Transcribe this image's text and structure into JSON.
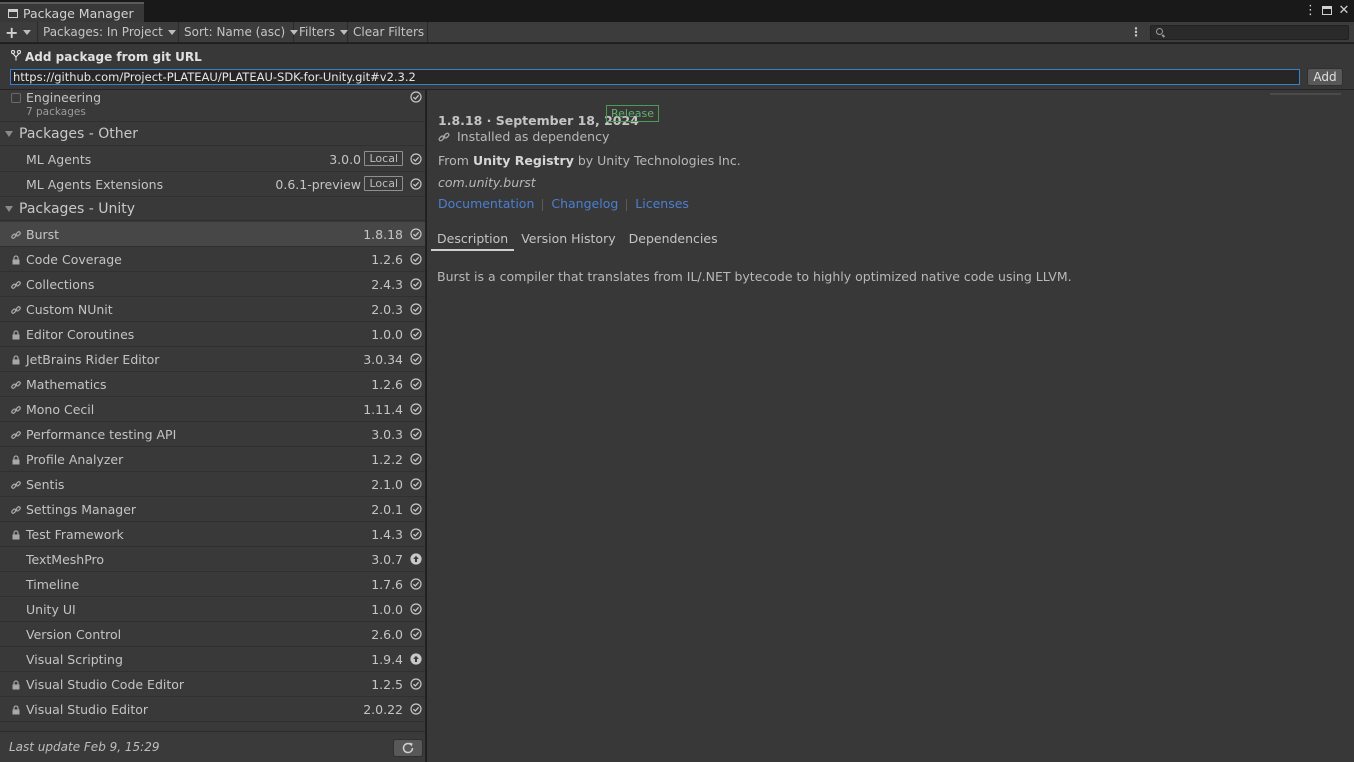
{
  "window": {
    "title": "Package Manager"
  },
  "toolbar": {
    "add_label": "+",
    "packages_filter": "Packages: In Project",
    "sort": "Sort: Name (asc)",
    "filters": "Filters",
    "clear_filters": "Clear Filters",
    "search_placeholder": ""
  },
  "git_panel": {
    "title": "Add package from git URL",
    "url": "https://github.com/Project-PLATEAU/PLATEAU-SDK-for-Unity.git#v2.3.2",
    "add_button": "Add"
  },
  "engineering": {
    "name": "Engineering",
    "count": "7 packages"
  },
  "groups": [
    {
      "name": "Packages - Other",
      "items": [
        {
          "name": "ML Agents",
          "version": "3.0.0",
          "badge": "Local",
          "icon": "none",
          "status": "check-icon"
        },
        {
          "name": "ML Agents Extensions",
          "version": "0.6.1-preview",
          "badge": "Local",
          "icon": "none",
          "status": "check-icon"
        }
      ]
    },
    {
      "name": "Packages - Unity",
      "items": [
        {
          "name": "Burst",
          "version": "1.8.18",
          "icon": "link-icon",
          "status": "check-icon",
          "selected": true
        },
        {
          "name": "Code Coverage",
          "version": "1.2.6",
          "icon": "lock-icon",
          "status": "check-icon"
        },
        {
          "name": "Collections",
          "version": "2.4.3",
          "icon": "link-icon",
          "status": "check-icon"
        },
        {
          "name": "Custom NUnit",
          "version": "2.0.3",
          "icon": "link-icon",
          "status": "check-icon"
        },
        {
          "name": "Editor Coroutines",
          "version": "1.0.0",
          "icon": "lock-icon",
          "status": "check-icon"
        },
        {
          "name": "JetBrains Rider Editor",
          "version": "3.0.34",
          "icon": "lock-icon",
          "status": "check-icon"
        },
        {
          "name": "Mathematics",
          "version": "1.2.6",
          "icon": "link-icon",
          "status": "check-icon"
        },
        {
          "name": "Mono Cecil",
          "version": "1.11.4",
          "icon": "link-icon",
          "status": "check-icon"
        },
        {
          "name": "Performance testing API",
          "version": "3.0.3",
          "icon": "link-icon",
          "status": "check-icon"
        },
        {
          "name": "Profile Analyzer",
          "version": "1.2.2",
          "icon": "lock-icon",
          "status": "check-icon"
        },
        {
          "name": "Sentis",
          "version": "2.1.0",
          "icon": "link-icon",
          "status": "check-icon"
        },
        {
          "name": "Settings Manager",
          "version": "2.0.1",
          "icon": "link-icon",
          "status": "check-icon"
        },
        {
          "name": "Test Framework",
          "version": "1.4.3",
          "icon": "lock-icon",
          "status": "check-icon"
        },
        {
          "name": "TextMeshPro",
          "version": "3.0.7",
          "icon": "none",
          "status": "update-icon"
        },
        {
          "name": "Timeline",
          "version": "1.7.6",
          "icon": "none",
          "status": "check-icon"
        },
        {
          "name": "Unity UI",
          "version": "1.0.0",
          "icon": "none",
          "status": "check-icon"
        },
        {
          "name": "Version Control",
          "version": "2.6.0",
          "icon": "none",
          "status": "check-icon"
        },
        {
          "name": "Visual Scripting",
          "version": "1.9.4",
          "icon": "none",
          "status": "update-icon"
        },
        {
          "name": "Visual Studio Code Editor",
          "version": "1.2.5",
          "icon": "lock-icon",
          "status": "check-icon"
        },
        {
          "name": "Visual Studio Editor",
          "version": "2.0.22",
          "icon": "lock-icon",
          "status": "check-icon"
        }
      ]
    }
  ],
  "footer": {
    "last_update": "Last update Feb 9, 15:29"
  },
  "details": {
    "version_line": "1.8.18 · September 18, 2024",
    "release_badge": "Release",
    "dependency": "Installed as dependency",
    "from_prefix": "From",
    "registry": "Unity Registry",
    "by": "by Unity Technologies Inc.",
    "package_id": "com.unity.burst",
    "links": [
      "Documentation",
      "Changelog",
      "Licenses"
    ],
    "tabs": [
      "Description",
      "Version History",
      "Dependencies"
    ],
    "description": "Burst is a compiler that translates from IL/.NET bytecode to highly optimized native code using LLVM."
  },
  "colors": {
    "accent_link": "#4b7fd1",
    "release_green": "#5fb36b",
    "input_focus": "#3b7ec9"
  }
}
